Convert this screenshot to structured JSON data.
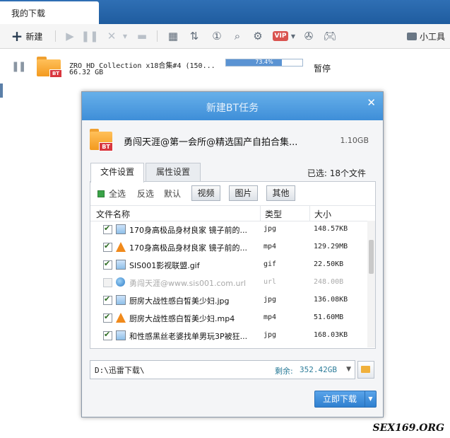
{
  "tabbar": {
    "tab_label": "我的下载"
  },
  "toolbar": {
    "new_label": "新建",
    "tools_label": "小工具",
    "vip_label": "VIP"
  },
  "download": {
    "name": "ZRO HD Collection x18合集#4 (150...",
    "size": "66.32 GB",
    "progress_text": "73.4%",
    "progress": 0.734,
    "status": "暂停"
  },
  "dialog": {
    "title": "新建BT任务",
    "task_name": "勇闯天涯@第一会所@精选国产自拍合集...",
    "task_size": "1.10GB",
    "tabs": [
      "文件设置",
      "属性设置"
    ],
    "selected_count": "已选: 18个文件",
    "filters": {
      "select_all": "全选",
      "invert": "反选",
      "default": "默认",
      "video": "视频",
      "image": "图片",
      "other": "其他"
    },
    "columns": {
      "name": "文件名称",
      "type": "类型",
      "size": "大小"
    },
    "files": [
      {
        "name": "170身高极品身材良家 镜子前的...",
        "type": "jpg",
        "size": "148.57KB",
        "icon": "image-file-icon",
        "checked": true
      },
      {
        "name": "170身高极品身材良家 镜子前的...",
        "type": "mp4",
        "size": "129.29MB",
        "icon": "video-file-icon",
        "checked": true
      },
      {
        "name": "SIS001影视联盟.gif",
        "type": "gif",
        "size": "22.50KB",
        "icon": "image-file-icon",
        "checked": true
      },
      {
        "name": "勇闯天涯@www.sis001.com.url",
        "type": "url",
        "size": "248.00B",
        "icon": "url-file-icon",
        "checked": false
      },
      {
        "name": "厨房大战性感白皙美少妇.jpg",
        "type": "jpg",
        "size": "136.08KB",
        "icon": "image-file-icon",
        "checked": true
      },
      {
        "name": "厨房大战性感白皙美少妇.mp4",
        "type": "mp4",
        "size": "51.60MB",
        "icon": "video-file-icon",
        "checked": true
      },
      {
        "name": "和性感黑丝老婆找单男玩3P被狂...",
        "type": "jpg",
        "size": "168.03KB",
        "icon": "image-file-icon",
        "checked": true
      }
    ],
    "path": "D:\\迅雷下载\\",
    "free_label": "剩余:",
    "free_value": "352.42GB",
    "download_button": "立即下载"
  },
  "watermark": "SEX169.ORG"
}
